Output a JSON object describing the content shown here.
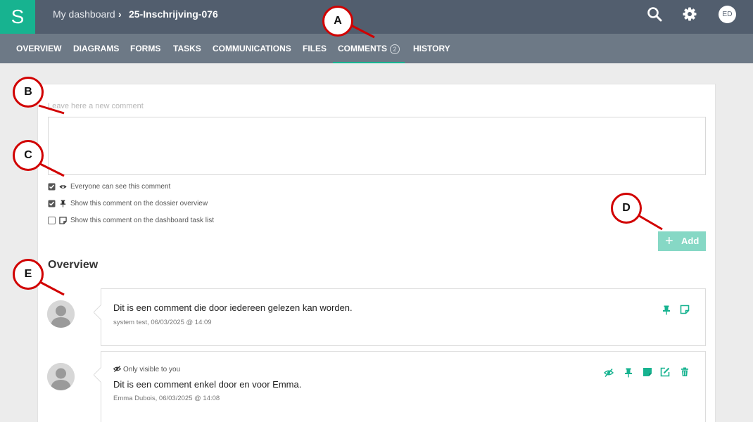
{
  "app": {
    "logo_letter": "S"
  },
  "breadcrumb": {
    "home": "My dashboard",
    "separator": "›",
    "current": "25-Inschrijving-076"
  },
  "user": {
    "initials": "ED"
  },
  "tabs": [
    {
      "label": "OVERVIEW"
    },
    {
      "label": "DIAGRAMS"
    },
    {
      "label": "FORMS"
    },
    {
      "label": "TASKS"
    },
    {
      "label": "COMMUNICATIONS"
    },
    {
      "label": "FILES"
    },
    {
      "label": "COMMENTS",
      "badge": "2",
      "active": true
    },
    {
      "label": "HISTORY"
    }
  ],
  "new_comment": {
    "hint": "Leave here a new comment",
    "value": "",
    "options": [
      {
        "label": "Everyone can see this comment",
        "checked": true,
        "icon": "eye-icon"
      },
      {
        "label": "Show this comment on the dossier overview",
        "checked": true,
        "icon": "pin-icon"
      },
      {
        "label": "Show this comment on the dashboard task list",
        "checked": false,
        "icon": "note-icon"
      }
    ],
    "add_label": "Add"
  },
  "overview": {
    "title": "Overview",
    "comments": [
      {
        "text": "Dit is een comment die door iedereen gelezen kan worden.",
        "meta": "system test, 06/03/2025 @ 14:09",
        "actions": [
          "pin-icon",
          "note-icon"
        ]
      },
      {
        "visibility": "Only visible to you",
        "text": "Dit is een comment enkel door en voor Emma.",
        "meta": "Emma Dubois, 06/03/2025 @ 14:08",
        "actions": [
          "eye-slash-icon",
          "pin-icon",
          "note-filled-icon",
          "edit-icon",
          "trash-icon"
        ]
      }
    ]
  },
  "annotations": [
    "A",
    "B",
    "C",
    "D",
    "E"
  ],
  "colors": {
    "accent": "#17b390",
    "topbar": "#525e6e",
    "tabbar": "#6d7986",
    "marker": "#d10000"
  }
}
